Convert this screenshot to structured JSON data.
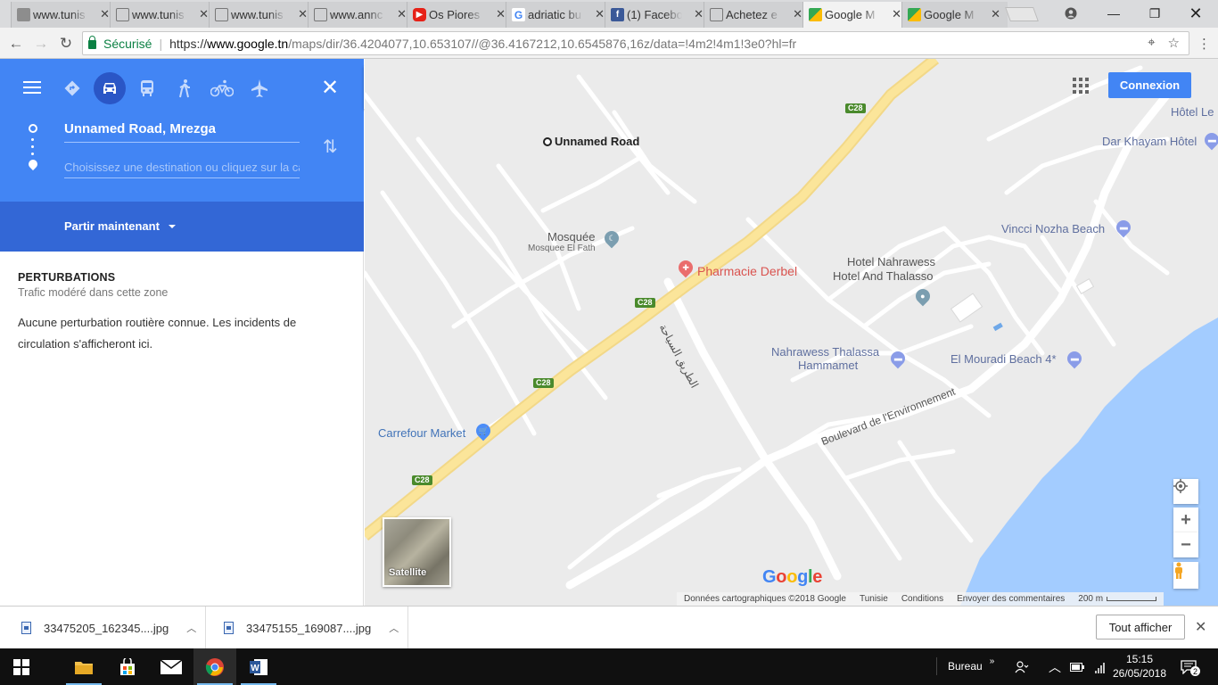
{
  "browser": {
    "tabs": [
      {
        "label": "www.tunis",
        "icon": "page-icon",
        "color": "#8d8d8d"
      },
      {
        "label": "www.tunis",
        "icon": "page-icon",
        "color": "#8d8d8d"
      },
      {
        "label": "www.tunis",
        "icon": "page-icon",
        "color": "#8d8d8d"
      },
      {
        "label": "www.annc",
        "icon": "page-icon",
        "color": "#8d8d8d"
      },
      {
        "label": "Os Piores",
        "icon": "youtube-icon",
        "color": "#e62117"
      },
      {
        "label": "adriatic bu",
        "icon": "google-icon",
        "color": "#4285f4"
      },
      {
        "label": "(1) Facebo",
        "icon": "facebook-icon",
        "color": "#3b5998"
      },
      {
        "label": "Achetez e",
        "icon": "page-icon",
        "color": "#8d8d8d"
      },
      {
        "label": "Google M",
        "icon": "maps-icon",
        "color": "#34a853"
      },
      {
        "label": "Google M",
        "icon": "maps-icon",
        "color": "#34a853"
      }
    ],
    "secure_label": "Sécurisé",
    "url_scheme": "https://",
    "url_host": "www.google.tn",
    "url_path": "/maps/dir/36.4204077,10.653107//@36.4167212,10.6545876,16z/data=!4m2!4m1!3e0?hl=fr"
  },
  "directions": {
    "origin": "Unnamed Road, Mrezga",
    "destination_placeholder": "Choisissez une destination ou cliquez sur la ca",
    "depart_label": "Partir maintenant",
    "selected_mode": "driving",
    "accent_color": "#4285f4"
  },
  "perturbations": {
    "title": "PERTURBATIONS",
    "subtitle": "Trafic modéré dans cette zone",
    "message": "Aucune perturbation routière connue. Les incidents de circulation s'afficheront ici."
  },
  "map": {
    "signin_label": "Connexion",
    "satellite_label": "Satellite",
    "google_logo": "Google",
    "road_badge": "C28",
    "labels": {
      "unnamed_road": "Unnamed Road",
      "mosque": "Mosquée",
      "mosque_sub": "Mosquee El Fath",
      "pharmacy": "Pharmacie Derbel",
      "carrefour": "Carrefour Market",
      "hotel_nahrawess_1": "Hotel Nahrawess",
      "hotel_nahrawess_2": "Hotel And Thalasso",
      "nahrawess_thalassa_1": "Nahrawess Thalassa",
      "nahrawess_thalassa_2": "Hammamet",
      "el_mouradi": "El Mouradi Beach 4*",
      "vincci": "Vincci Nozha Beach",
      "dar_khayam": "Dar Khayam Hôtel",
      "hotel_le": "Hôtel Le",
      "boulevard": "Boulevard de l'Environnement",
      "arabic_road": "الطريق السياحة"
    },
    "attribution": [
      "Données cartographiques ©2018 Google",
      "Tunisie",
      "Conditions",
      "Envoyer des commentaires"
    ],
    "scale": "200 m"
  },
  "downloads": {
    "items": [
      "33475205_162345....jpg",
      "33475155_169087....jpg"
    ],
    "show_all": "Tout afficher"
  },
  "taskbar": {
    "desktop_label": "Bureau",
    "time": "15:15",
    "date": "26/05/2018",
    "notification_count": "2"
  }
}
